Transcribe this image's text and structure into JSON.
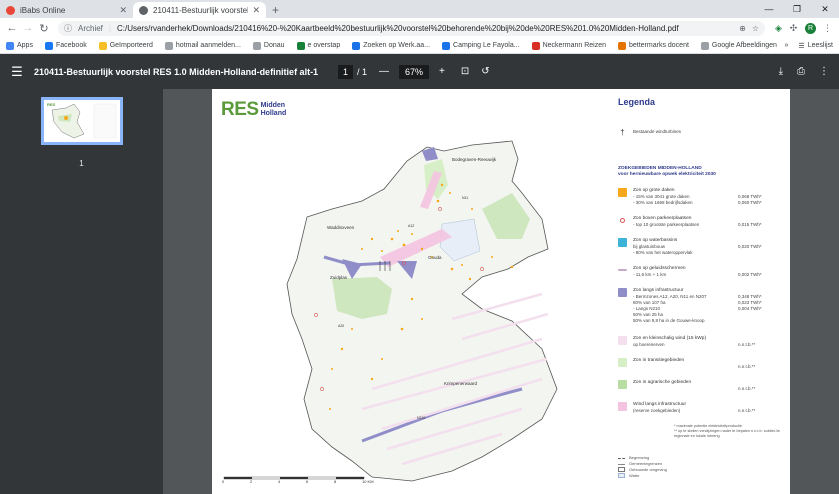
{
  "browser": {
    "tabs": [
      {
        "title": "iBabs Online",
        "active": false,
        "favicon_color": "#e8473a"
      },
      {
        "title": "210411-Bestuurlijk voorstel RES",
        "active": true,
        "favicon_color": "#5f6368"
      }
    ],
    "new_tab": "+",
    "address": {
      "security_label": "Archief",
      "url": "C:/Users/rvanderhek/Downloads/210416%20-%20Kaartbeeld%20bestuurlijk%20voorstel%20behorende%20bij%20de%20RES%201.0%20Midden-Holland.pdf"
    },
    "profile_initial": "R",
    "bookmarks": [
      {
        "label": "Apps",
        "color": "#4285f4"
      },
      {
        "label": "Facebook",
        "color": "#1877f2"
      },
      {
        "label": "Geïmporteerd",
        "color": "#f6bf26"
      },
      {
        "label": "hotmail aanmelden...",
        "color": "#9aa0a6"
      },
      {
        "label": "Donau",
        "color": "#9aa0a6"
      },
      {
        "label": "e overstap",
        "color": "#188038"
      },
      {
        "label": "Zoeken op Werk.aa...",
        "color": "#1a73e8"
      },
      {
        "label": "Camping Le Fayola...",
        "color": "#1a73e8"
      },
      {
        "label": "Neckermann Reizen",
        "color": "#d93025"
      },
      {
        "label": "bettermarks docent",
        "color": "#e37400"
      },
      {
        "label": "Google Afbeeldingen",
        "color": "#9aa0a6"
      }
    ],
    "more_bookmarks": "»",
    "reading_list": "Leeslijst"
  },
  "pdf": {
    "title": "210411-Bestuurlijk voorstel RES 1.0 Midden-Holland-definitief alt-1",
    "current_page": "1",
    "total_pages": "/ 1",
    "zoom": "67%",
    "thumbnail_number": "1"
  },
  "map": {
    "logo_res": "RES",
    "logo_line1": "Midden",
    "logo_line2": "Holland",
    "places": {
      "bodegraven": "Bodegraven-Reeuwijk",
      "waddinxveen": "Waddinxveen",
      "gouda": "Gouda",
      "zuidplas": "Zuidplas",
      "krimpenerwaard": "Krimpenerwaard",
      "a12": "A12",
      "a20": "A20",
      "n210": "N210",
      "n11": "N11"
    },
    "scale": {
      "labels": [
        "0",
        "2",
        "4",
        "6",
        "8",
        "10 KM"
      ]
    }
  },
  "legend": {
    "title": "Legenda",
    "existing_turbines": "Bestaande windturbines",
    "section_title_1": "ZOEKGEBIEDEN MIDDEN-HOLLAND",
    "section_title_2": "voor hernieuwbare opwek elektriciteit 2030",
    "items": [
      {
        "title": "Zon op grote daken",
        "sub": "- 15% van 3041 grote daken\n- 30% van 1668 bedrijfsdaken",
        "value": "0,068 TWh*\n0,060 TWh*",
        "color": "#f6a81a"
      },
      {
        "title": "Zon boven parkeerplaatsen",
        "sub": "- top 10 grootste parkeerplaatsen",
        "value": "0,015 TWh*",
        "color": "#ffffff"
      },
      {
        "title": "Zon op waterbassins",
        "sub": "bij glastuinbouw\n- 80% van het wateroppervlak",
        "value": "0,020 TWh*",
        "color": "#3db3d8"
      },
      {
        "title": "Zon op geluidsschermen",
        "sub": "- 11,6 km + 1 km",
        "value": "0,002 TWh*",
        "color": "#c7a8c9"
      },
      {
        "title": "Zon langs infrastructuur",
        "sub": "- Bermzones A12, A20, N11 en N207\n  80% van 107 ha\n- Langs N210\n  50% van 25 ha\n  50% van 9,8 ha in de Gouwe-knoop",
        "value": "0,348 TWh*\n0,023 TWh*\n0,004 TWh*",
        "color": "#8f8ec9"
      },
      {
        "title": "Zon en kleinschalig wind (15 kWp)",
        "sub": "op boerenerven",
        "value": "n.n.t.b.**",
        "color": "#f3dfee"
      },
      {
        "title": "Zon in transitiegebieden",
        "sub": "",
        "value": "n.n.t.b.**",
        "color": "#d7efc6"
      },
      {
        "title": "Zon in agrarische gebieden",
        "sub": "",
        "value": "n.n.t.b.**",
        "color": "#b9dea3"
      },
      {
        "title": "Wind langs infrastructuur",
        "sub": "(reserve zoekgebieden)",
        "value": "n.n.t.b.**",
        "color": "#f4c3e0"
      }
    ],
    "footnote1": "* maximale potentie elektriciteitproductie",
    "footnote2": "** op te stellen verwijzingen nader te bepalen n.n.t.b. subtiel-/ie regionale en lokale inbreng",
    "base_items": [
      "Begrenzing",
      "Gemeentegrenzen",
      "Gebouwde omgeving",
      "Water"
    ]
  }
}
